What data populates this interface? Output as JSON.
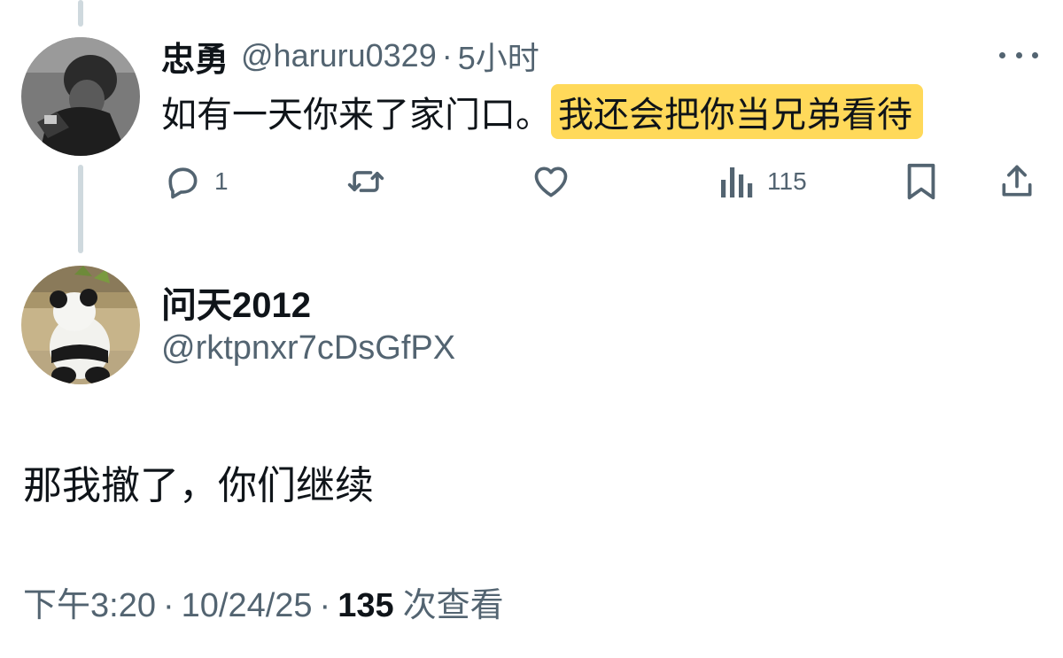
{
  "reply_tweet": {
    "author_name": "忠勇",
    "handle": "@haruru0329",
    "separator": "·",
    "time": "5小时",
    "text_plain": "如有一天你来了家门口。",
    "text_highlighted": "我还会把你当兄弟看待",
    "highlight_color": "#ffd95a",
    "actions": {
      "reply_count": "1",
      "retweet_count": "",
      "like_count": "",
      "views_count": "115"
    }
  },
  "main_tweet": {
    "author_name": "问天2012",
    "handle": "@rktpnxr7cDsGfPX",
    "text": "那我撤了，你们继续",
    "time": "下午3:20",
    "date": "10/24/25",
    "separator": "·",
    "views_count": "135",
    "views_label": "次查看"
  },
  "colors": {
    "text_primary": "#0f1419",
    "text_secondary": "#536471",
    "thread_line": "#cfd9de"
  },
  "icons": [
    "reply-icon",
    "retweet-icon",
    "like-icon",
    "views-icon",
    "bookmark-icon",
    "share-icon",
    "more-icon"
  ]
}
